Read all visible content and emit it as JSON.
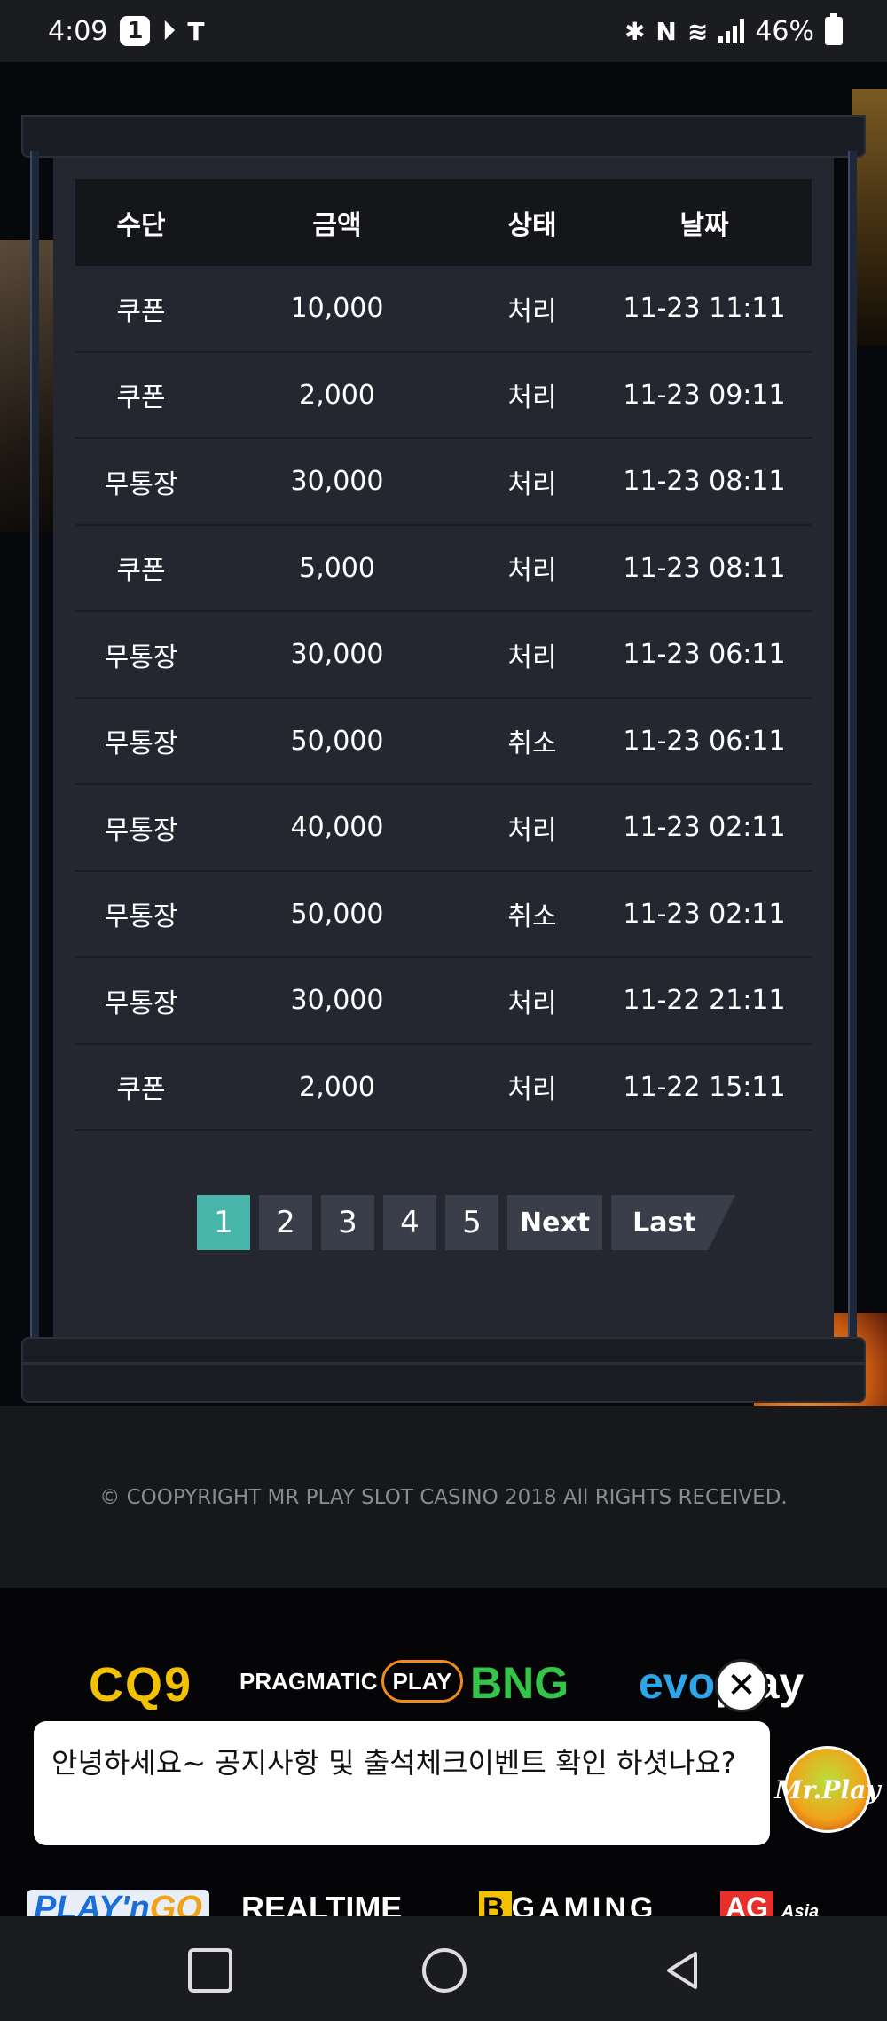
{
  "status_bar": {
    "time": "4:09",
    "notif_badge": "1",
    "battery": "46%"
  },
  "table": {
    "headers": [
      "수단",
      "금액",
      "상태",
      "날짜"
    ],
    "rows": [
      [
        "쿠폰",
        "10,000",
        "처리",
        "11-23 11:11"
      ],
      [
        "쿠폰",
        "2,000",
        "처리",
        "11-23 09:11"
      ],
      [
        "무통장",
        "30,000",
        "처리",
        "11-23 08:11"
      ],
      [
        "쿠폰",
        "5,000",
        "처리",
        "11-23 08:11"
      ],
      [
        "무통장",
        "30,000",
        "처리",
        "11-23 06:11"
      ],
      [
        "무통장",
        "50,000",
        "취소",
        "11-23 06:11"
      ],
      [
        "무통장",
        "40,000",
        "처리",
        "11-23 02:11"
      ],
      [
        "무통장",
        "50,000",
        "취소",
        "11-23 02:11"
      ],
      [
        "무통장",
        "30,000",
        "처리",
        "11-22 21:11"
      ],
      [
        "쿠폰",
        "2,000",
        "처리",
        "11-22 15:11"
      ]
    ]
  },
  "pagination": {
    "pages": [
      "1",
      "2",
      "3",
      "4",
      "5"
    ],
    "current": "1",
    "next": "Next",
    "last": "Last"
  },
  "footer": {
    "copyright": "© COOPYRIGHT MR PLAY SLOT CASINO 2018 All RIGHTS RECEIVED."
  },
  "partners": {
    "cq9": "CQ9",
    "pragmatic": "PRAGMATIC",
    "pragmatic_play": "PLAY",
    "bng": "BNG",
    "evo_a": "evo",
    "evo_b": "play",
    "playngo_a": "PLAY'n",
    "playngo_b": "GO",
    "realtime": "REALTIME",
    "bgaming_b": "B",
    "bgaming": "GAMING",
    "ag": "AG",
    "ag_asia": "Asia"
  },
  "chat": {
    "message": "안녕하세요~ 공지사항 및 출석체크이벤트 확인 하셧나요?",
    "close": "✕",
    "avatar": "Mr.Play"
  },
  "colors": {
    "accent": "#48b5ab",
    "panel": "#242730",
    "header": "#15161a"
  }
}
